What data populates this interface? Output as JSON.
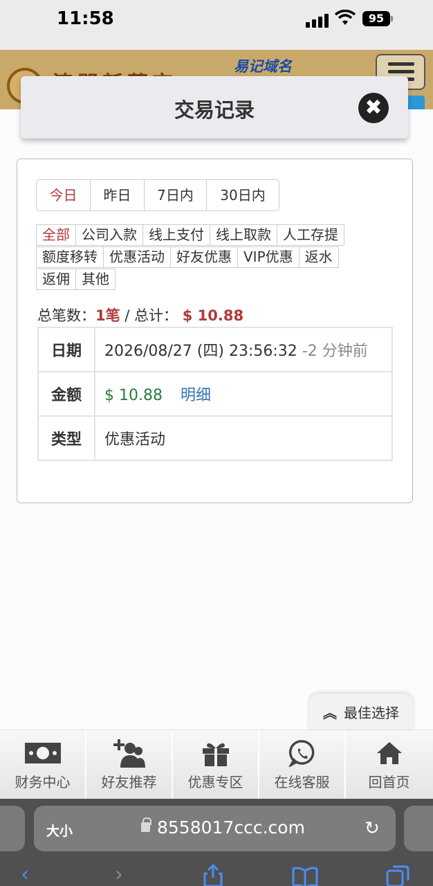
{
  "status": {
    "time": "11:58",
    "battery": "95"
  },
  "site": {
    "logo_text": "澳門新葡京",
    "domain_label": "易记域名"
  },
  "modal": {
    "title": "交易记录",
    "close_glyph": "✖"
  },
  "periods": {
    "items": [
      "今日",
      "昨日",
      "7日内",
      "30日内"
    ],
    "active_index": 0
  },
  "types": {
    "row1": [
      "全部",
      "公司入款",
      "线上支付",
      "线上取款",
      "人工存提"
    ],
    "row2": [
      "额度移转",
      "优惠活动",
      "好友优惠",
      "VIP优惠",
      "返水"
    ],
    "row3": [
      "返佣",
      "其他"
    ],
    "active": "全部"
  },
  "summary": {
    "count_label": "总笔数：",
    "count": "1笔",
    "sep": " / ",
    "total_label": "总计：",
    "total": "$ 10.88"
  },
  "record": {
    "date_label": "日期",
    "date": "2026/08/27 (四) 23:56:32",
    "ago": "-2 分钟前",
    "amount_label": "金额",
    "amount": "$ 10.88",
    "detail_link": "明细",
    "type_label": "类型",
    "type": "优惠活动"
  },
  "best_choice": {
    "icon": "chevron-up-icon",
    "label": "最佳选择"
  },
  "bottom_nav": [
    {
      "label": "财务中心",
      "icon": "money-icon"
    },
    {
      "label": "好友推荐",
      "icon": "add-user-icon"
    },
    {
      "label": "优惠专区",
      "icon": "gift-icon"
    },
    {
      "label": "在线客服",
      "icon": "whatsapp-icon"
    },
    {
      "label": "回首页",
      "icon": "home-icon"
    }
  ],
  "browser": {
    "text_size": "大小",
    "url": "8558017ccc.com"
  },
  "colors": {
    "accent_red": "#b03a3a",
    "amount_green": "#2c7a3c",
    "link_blue": "#2f72b8",
    "ios_blue": "#4d8cf5"
  }
}
